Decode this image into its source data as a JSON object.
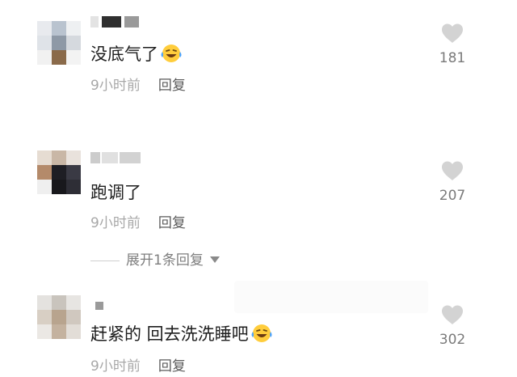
{
  "comments": [
    {
      "text": "没底气了",
      "emoji": "laughing-crying-emoji",
      "time": "9小时前",
      "reply_label": "回复",
      "likes": "181"
    },
    {
      "text": "跑调了",
      "time": "9小时前",
      "reply_label": "回复",
      "likes": "207",
      "expand_label": "展开1条回复"
    },
    {
      "text": "赶紧的 回去洗洗睡吧",
      "emoji": "laughing-crying-emoji",
      "time": "9小时前",
      "reply_label": "回复",
      "likes": "302"
    }
  ],
  "icons": {
    "like": "heart-icon",
    "expand": "triangle-down-icon"
  },
  "colors": {
    "text": "#1e1e1e",
    "meta": "#a8a8a8",
    "heart": "#d3d3d3",
    "count": "#7a7a7a"
  }
}
